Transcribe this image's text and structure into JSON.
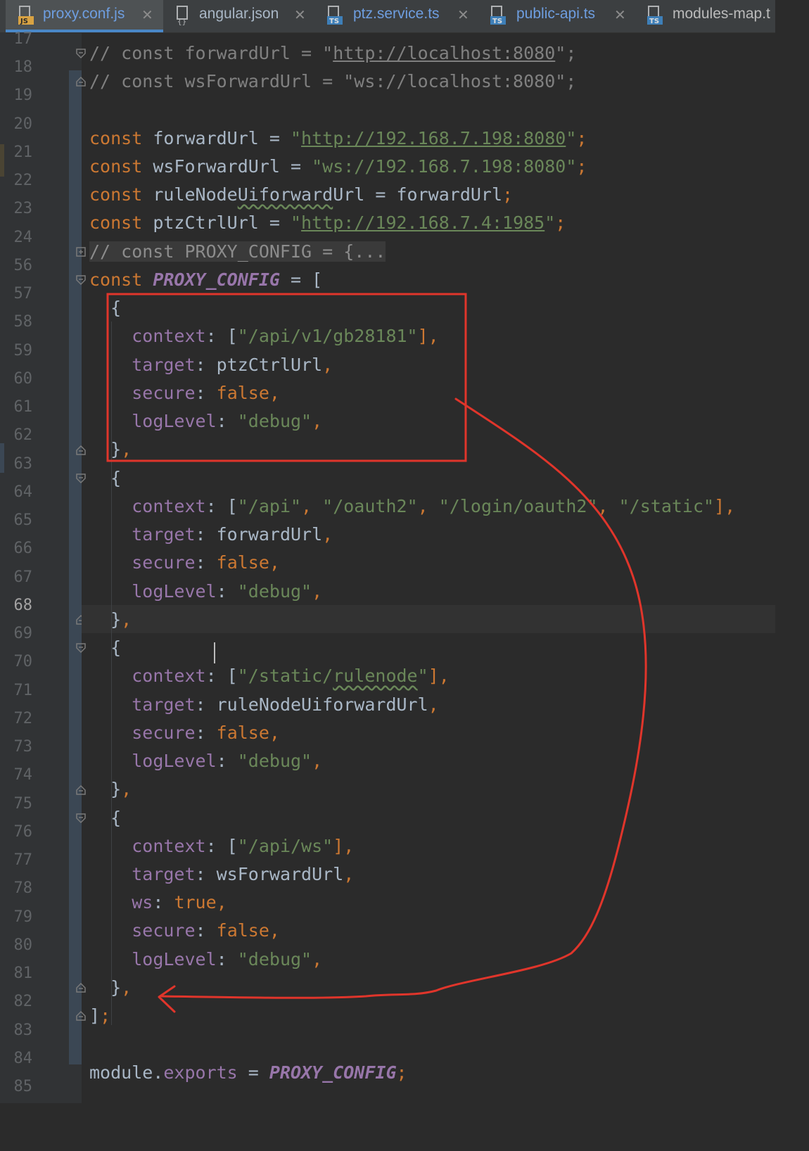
{
  "tabs": [
    {
      "label": "proxy.conf.js",
      "icon": "js-file-icon",
      "active": true
    },
    {
      "label": "angular.json",
      "icon": "json-file-icon",
      "active": false
    },
    {
      "label": "ptz.service.ts",
      "icon": "ts-file-icon",
      "active": false
    },
    {
      "label": "public-api.ts",
      "icon": "ts-file-icon",
      "active": false
    },
    {
      "label": "modules-map.t",
      "icon": "ts-file-icon",
      "active": false
    }
  ],
  "tab_close_glyph": "✕",
  "current_line": "68",
  "line_numbers": [
    "17",
    "18",
    "19",
    "20",
    "21",
    "22",
    "23",
    "24",
    "56",
    "57",
    "58",
    "59",
    "60",
    "61",
    "62",
    "63",
    "64",
    "65",
    "66",
    "67",
    "68",
    "69",
    "70",
    "71",
    "72",
    "73",
    "74",
    "75",
    "76",
    "77",
    "78",
    "79",
    "80",
    "81",
    "82",
    "83",
    "84",
    "85"
  ],
  "code": {
    "l17": {
      "c1": "// const forwardUrl = \"",
      "c2": "http://localhost:8080",
      "c3": "\";"
    },
    "l18": {
      "c1": "// const wsForwardUrl = \"ws://localhost:8080\";"
    },
    "l20": {
      "kw": "const",
      "name": " forwardUrl = ",
      "q1": "\"",
      "url": "http://192.168.7.198:8080",
      "q2": "\"",
      "semi": ";"
    },
    "l21": {
      "kw": "const",
      "name": " wsForwardUrl = ",
      "str": "\"ws://192.168.7.198:8080\"",
      "semi": ";"
    },
    "l22": {
      "kw": "const",
      "name1": " ruleNode",
      "typo": "Uiforward",
      "name2": "Url = forwardUrl",
      "semi": ";"
    },
    "l23": {
      "kw": "const",
      "name": " ptzCtrlUrl = ",
      "q1": "\"",
      "url": "http://192.168.7.4:1985",
      "q2": "\"",
      "semi": ";"
    },
    "l24": {
      "c1": "// const PROXY_CONFIG = {...",
      "c2": ""
    },
    "l56": {
      "kw": "const",
      "sp": " ",
      "const": "PROXY_CONFIG",
      "rest": " = ["
    },
    "l57": {
      "t": "  {"
    },
    "l58": {
      "prop": "context",
      "c": ": [",
      "s": "\"/api/v1/gb28181\"",
      "e": "],"
    },
    "l59": {
      "prop": "target",
      "c": ": ptzCtrlUrl",
      "e": ","
    },
    "l60": {
      "prop": "secure",
      "c": ": ",
      "kw": "false",
      "e": ","
    },
    "l61": {
      "prop": "logLevel",
      "c": ": ",
      "s": "\"debug\"",
      "e": ","
    },
    "l62": {
      "t": "  }",
      "e": ","
    },
    "l63": {
      "t": "  {"
    },
    "l64": {
      "prop": "context",
      "c": ": [",
      "s1": "\"/api\"",
      "cm1": ", ",
      "s2": "\"/oauth2\"",
      "cm2": ", ",
      "s3": "\"/login/oauth2\"",
      "cm3": ", ",
      "s4": "\"/static\"",
      "e": "],"
    },
    "l65": {
      "prop": "target",
      "c": ": forwardUrl",
      "e": ","
    },
    "l66": {
      "prop": "secure",
      "c": ": ",
      "kw": "false",
      "e": ","
    },
    "l67": {
      "prop": "logLevel",
      "c": ": ",
      "s": "\"debug\"",
      "e": ","
    },
    "l68": {
      "t": "  }",
      "e": ","
    },
    "l69": {
      "t": "  {"
    },
    "l70": {
      "prop": "context",
      "c": ": [",
      "s1": "\"/static/",
      "typo": "rulenode",
      "s2": "\"",
      "e": "],"
    },
    "l71": {
      "prop": "target",
      "c": ": ruleNodeUiforwardUrl",
      "e": ","
    },
    "l72": {
      "prop": "secure",
      "c": ": ",
      "kw": "false",
      "e": ","
    },
    "l73": {
      "prop": "logLevel",
      "c": ": ",
      "s": "\"debug\"",
      "e": ","
    },
    "l74": {
      "t": "  }",
      "e": ","
    },
    "l75": {
      "t": "  {"
    },
    "l76": {
      "prop": "context",
      "c": ": [",
      "s": "\"/api/ws\"",
      "e": "],"
    },
    "l77": {
      "prop": "target",
      "c": ": wsForwardUrl",
      "e": ","
    },
    "l78": {
      "prop": "ws",
      "c": ": ",
      "kw": "true",
      "e": ","
    },
    "l79": {
      "prop": "secure",
      "c": ": ",
      "kw": "false",
      "e": ","
    },
    "l80": {
      "prop": "logLevel",
      "c": ": ",
      "s": "\"debug\"",
      "e": ","
    },
    "l81": {
      "t": "  }",
      "e": ","
    },
    "l82": {
      "t": "]",
      "e": ";"
    },
    "l84": {
      "t1": "module.",
      "prop": "exports",
      "t2": " = ",
      "const": "PROXY_CONFIG",
      "e": ";"
    }
  },
  "colors": {
    "annotation": "#e0352b",
    "keyword": "#cc7832",
    "string": "#6a8759",
    "property": "#9876aa",
    "text": "#a9b7c6",
    "background": "#2b2b2b"
  }
}
